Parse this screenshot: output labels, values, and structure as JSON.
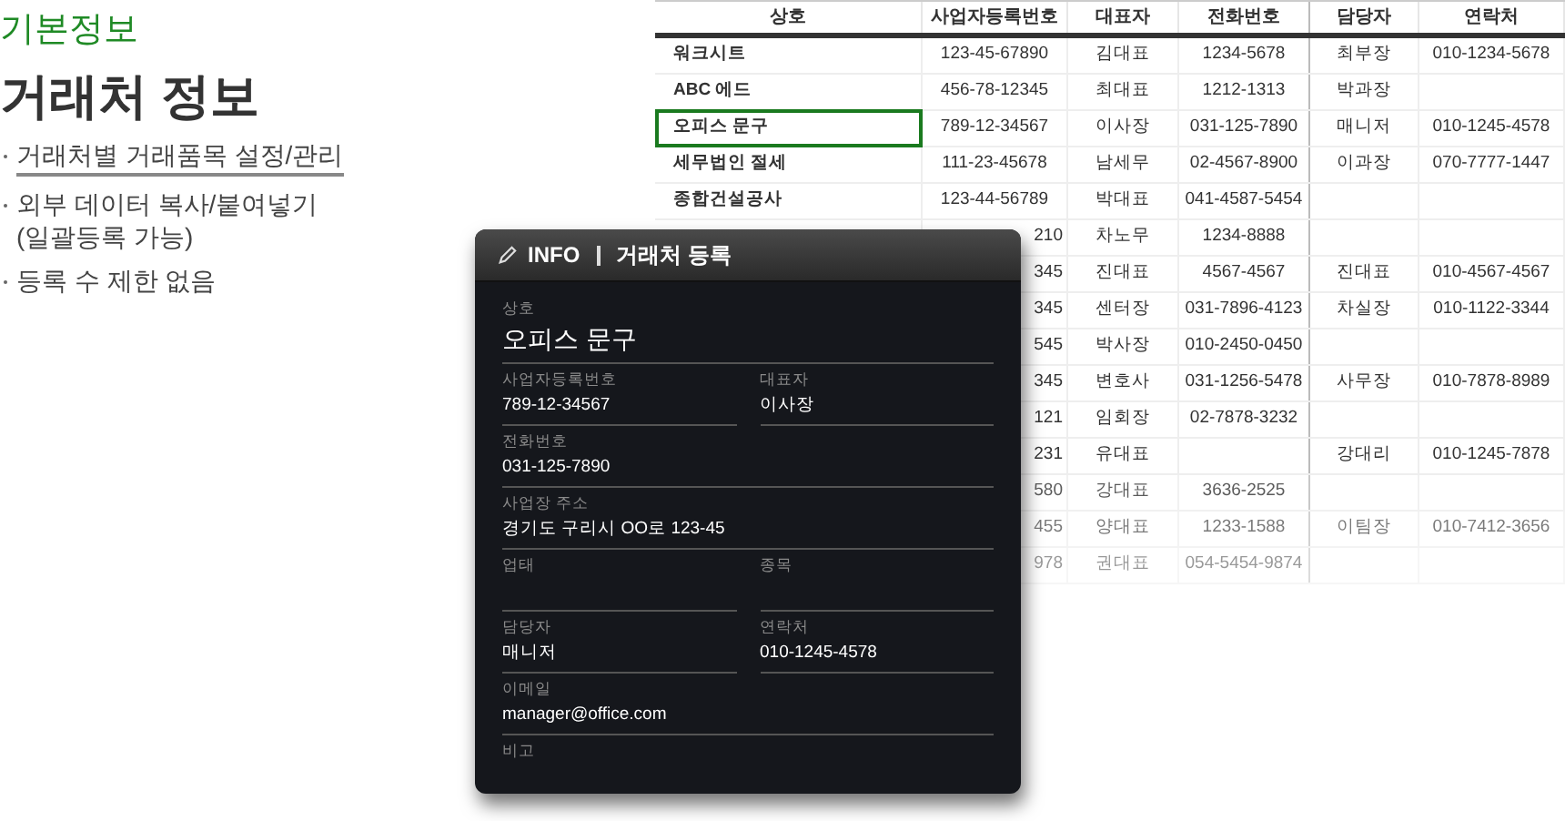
{
  "intro": {
    "category": "기본정보",
    "title": "거래처 정보",
    "bullets": [
      {
        "text": "거래처별 거래품목 설정/관리",
        "underlined": true
      },
      {
        "text": "외부 데이터 복사/붙여넣기\n(일괄등록 가능)",
        "underlined": false
      },
      {
        "text": "등록 수 제한 없음",
        "underlined": false
      }
    ]
  },
  "table": {
    "columns": [
      "상호",
      "사업자등록번호",
      "대표자",
      "전화번호",
      "담당자",
      "연락처"
    ],
    "rows": [
      {
        "name": "워크시트",
        "reg_no": "123-45-67890",
        "ceo": "김대표",
        "phone": "1234-5678",
        "manager": "최부장",
        "contact": "010-1234-5678",
        "selected": false
      },
      {
        "name": "ABC 에드",
        "reg_no": "456-78-12345",
        "ceo": "최대표",
        "phone": "1212-1313",
        "manager": "박과장",
        "selected": false
      },
      {
        "name": "오피스 문구",
        "reg_no": "789-12-34567",
        "ceo": "이사장",
        "phone": "031-125-7890",
        "manager": "매니저",
        "contact": "010-1245-4578",
        "selected": true
      },
      {
        "name": "세무법인 절세",
        "reg_no": "111-23-45678",
        "ceo": "남세무",
        "phone": "02-4567-8900",
        "manager": "이과장",
        "contact": "070-7777-1447",
        "selected": false
      },
      {
        "name": "종합건설공사",
        "reg_no": "123-44-56789",
        "ceo": "박대표",
        "phone": "041-4587-5454",
        "selected": false
      },
      {
        "reg_no": "210",
        "ceo": "차노무",
        "phone": "1234-8888",
        "selected": false
      },
      {
        "reg_no": "345",
        "ceo": "진대표",
        "phone": "4567-4567",
        "manager": "진대표",
        "contact": "010-4567-4567",
        "selected": false
      },
      {
        "reg_no": "345",
        "ceo": "센터장",
        "phone": "031-7896-4123",
        "manager": "차실장",
        "contact": "010-1122-3344",
        "selected": false
      },
      {
        "reg_no": "545",
        "ceo": "박사장",
        "phone": "010-2450-0450",
        "selected": false
      },
      {
        "reg_no": "345",
        "ceo": "변호사",
        "phone": "031-1256-5478",
        "manager": "사무장",
        "contact": "010-7878-8989",
        "selected": false
      },
      {
        "reg_no": "121",
        "ceo": "임회장",
        "phone": "02-7878-3232",
        "selected": false
      },
      {
        "reg_no": "231",
        "ceo": "유대표",
        "manager": "강대리",
        "contact": "010-1245-7878",
        "selected": false
      },
      {
        "reg_no": "580",
        "ceo": "강대표",
        "phone": "3636-2525",
        "selected": false
      },
      {
        "reg_no": "455",
        "ceo": "양대표",
        "phone": "1233-1588",
        "manager": "이팀장",
        "contact": "010-7412-3656",
        "selected": false
      },
      {
        "reg_no": "978",
        "ceo": "권대표",
        "phone": "054-5454-9874",
        "selected": false
      }
    ]
  },
  "dialog": {
    "tag": "INFO",
    "title": "거래처 등록",
    "rows": [
      [
        {
          "label": "상호",
          "value": "오피스 문구",
          "kind": "title"
        }
      ],
      [
        {
          "label": "사업자등록번호",
          "value": "789-12-34567",
          "kind": "text"
        },
        {
          "label": "대표자",
          "value": "이사장",
          "kind": "text"
        }
      ],
      [
        {
          "label": "전화번호",
          "value": "031-125-7890",
          "kind": "text"
        }
      ],
      [
        {
          "label": "사업장 주소",
          "value": "경기도 구리시 OO로 123-45",
          "kind": "text"
        }
      ],
      [
        {
          "label": "업태",
          "kind": "text"
        },
        {
          "label": "종목",
          "kind": "text"
        }
      ],
      [
        {
          "label": "담당자",
          "value": "매니저",
          "kind": "text"
        },
        {
          "label": "연락처",
          "value": "010-1245-4578",
          "kind": "text"
        }
      ],
      [
        {
          "label": "이메일",
          "value": "manager@office.com",
          "kind": "text"
        }
      ],
      [
        {
          "label": "비고",
          "kind": "text"
        }
      ]
    ]
  }
}
